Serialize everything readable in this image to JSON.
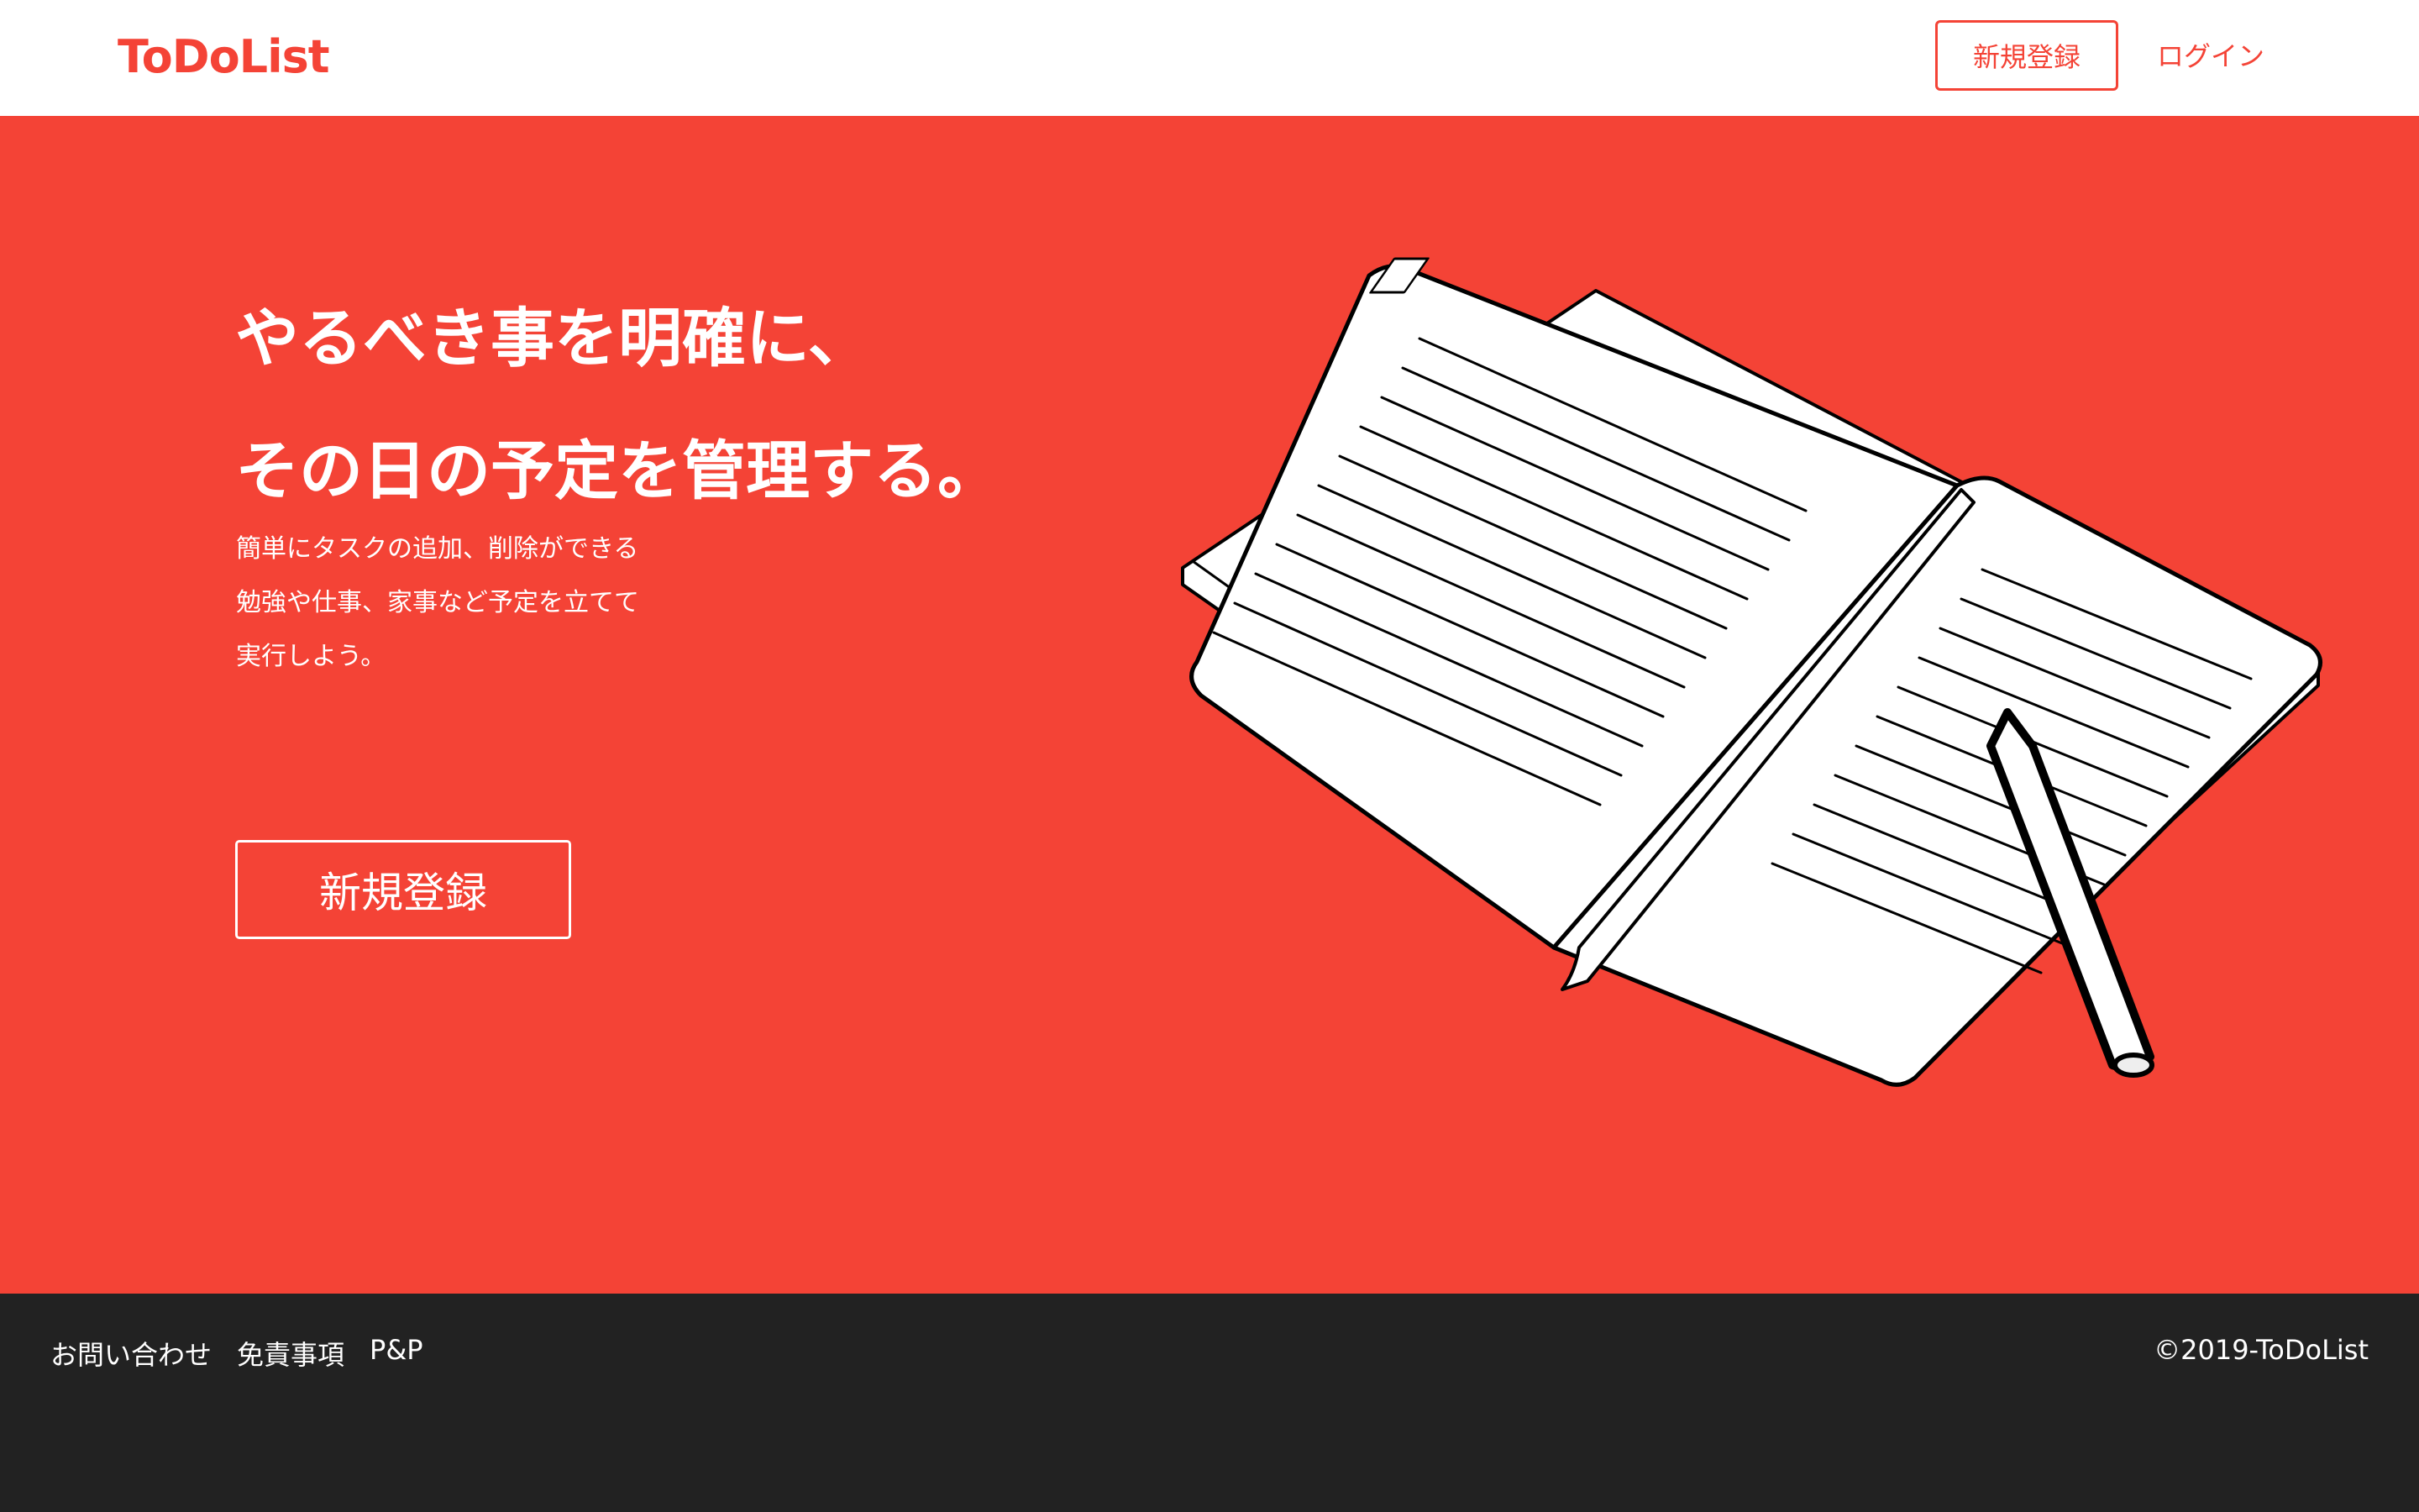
{
  "header": {
    "logo": "ToDoList",
    "signup_label": "新規登録",
    "login_label": "ログイン"
  },
  "hero": {
    "headline_line1": "やるべき事を明確に、",
    "headline_line2": "その日の予定を管理する。",
    "description": [
      "簡単にタスクの追加、削除ができる",
      "勉強や仕事、家事など予定を立てて",
      "実行しよう。"
    ],
    "signup_label": "新規登録",
    "illustration_icon": "open-notebook-with-pencil-icon"
  },
  "footer": {
    "links": [
      "お問い合わせ",
      "免責事項",
      "P&P"
    ],
    "copyright": "©2019-ToDoList"
  },
  "colors": {
    "accent": "#f44336",
    "footer_bg": "#222222",
    "header_bg": "#ffffff"
  }
}
